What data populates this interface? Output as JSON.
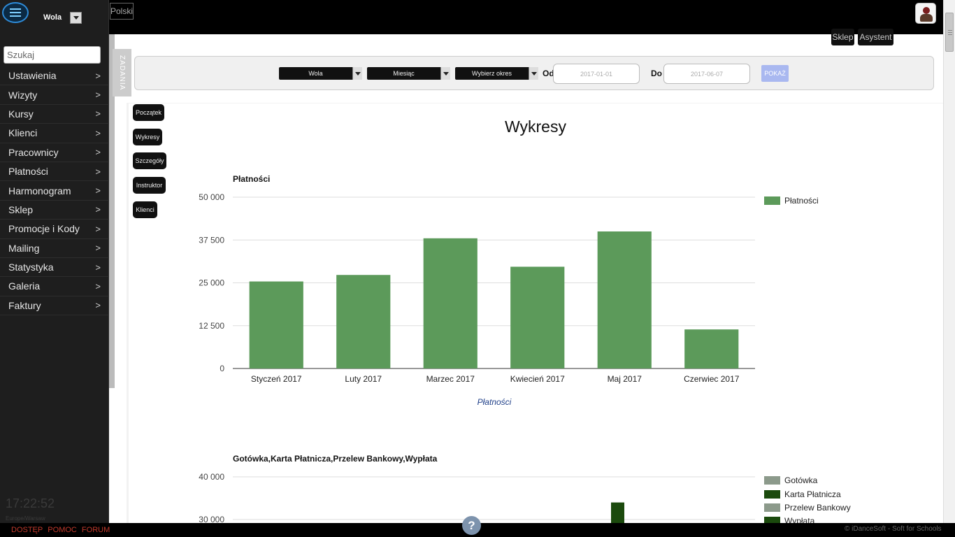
{
  "sidebar": {
    "branch": "Wola",
    "search_placeholder": "Szukaj",
    "items": [
      {
        "label": "Ustawienia"
      },
      {
        "label": "Wizyty"
      },
      {
        "label": "Kursy"
      },
      {
        "label": "Klienci"
      },
      {
        "label": "Pracownicy"
      },
      {
        "label": "Płatności"
      },
      {
        "label": "Harmonogram"
      },
      {
        "label": "Sklep"
      },
      {
        "label": "Promocje i Kody"
      },
      {
        "label": "Mailing"
      },
      {
        "label": "Statystyka"
      },
      {
        "label": "Galeria"
      },
      {
        "label": "Faktury"
      }
    ],
    "chevron": ">",
    "clock": "17:22:52",
    "timezone": "Europe/Warsaw"
  },
  "topbar": {
    "language": "Polski",
    "shop": "Sklep",
    "assistant": "Asystent"
  },
  "tasks_tab": "ZADANIA",
  "filters": {
    "branch": "Wola",
    "period_type": "Miesiąc",
    "period": "Wybierz okres",
    "from_label": "Od",
    "from_value": "2017-01-01",
    "to_label": "Do",
    "to_value": "2017-06-07",
    "show": "POKAŻ"
  },
  "side_nav": [
    "Początek",
    "Wykresy",
    "Szczegóły",
    "Instruktor",
    "Klienci"
  ],
  "page_title": "Wykresy",
  "chart_data": [
    {
      "type": "bar",
      "title": "Płatności",
      "xlabel": "Płatności",
      "ylabel": "",
      "categories": [
        "Styczeń 2017",
        "Luty 2017",
        "Marzec 2017",
        "Kwiecień 2017",
        "Maj 2017",
        "Czerwiec 2017"
      ],
      "series": [
        {
          "name": "Płatności",
          "color": "#5c9a5a",
          "values": [
            25400,
            27300,
            38000,
            29700,
            40000,
            11400
          ]
        }
      ],
      "yticks": [
        "50 000",
        "37 500",
        "25 000",
        "12 500",
        "0"
      ],
      "ylim": [
        0,
        50000
      ],
      "grid": true,
      "legend": "right"
    },
    {
      "type": "bar",
      "title": "Gotówka,Karta Płatnicza,Przelew Bankowy,Wypłata",
      "yticks": [
        "40 000",
        "30 000"
      ],
      "ylim": [
        0,
        40000
      ],
      "grid": true,
      "legend": "right",
      "series": [
        {
          "name": "Gotówka",
          "color": "#8c9a8b"
        },
        {
          "name": "Karta Płatnicza",
          "color": "#1b4a0d"
        },
        {
          "name": "Przelew Bankowy",
          "color": "#8c9a8b"
        },
        {
          "name": "Wypłata",
          "color": "#1b4a0d"
        }
      ],
      "visible_bar": {
        "category_index": 4,
        "series": "Karta Płatnicza",
        "value": 34000
      }
    }
  ],
  "footer": {
    "links": [
      "DOSTĘP",
      "POMOC",
      "FORUM"
    ],
    "copyright": "© iDanceSoft - Soft for Schools",
    "help": "?"
  }
}
